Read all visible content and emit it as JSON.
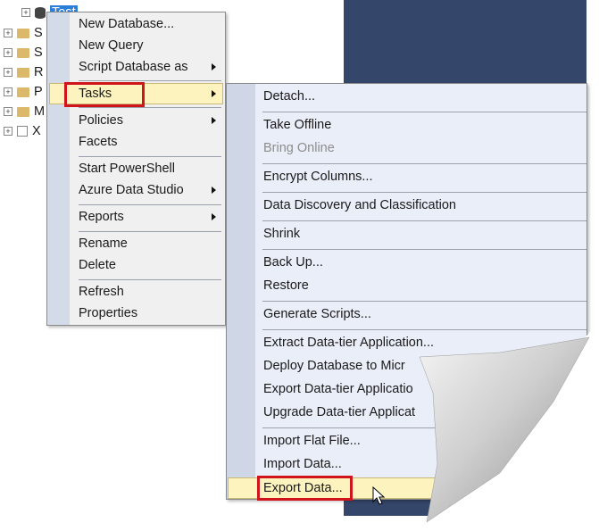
{
  "tree": {
    "selected": "Test",
    "items": [
      "S",
      "S",
      "R",
      "P",
      "M",
      "X"
    ]
  },
  "context_menu": [
    {
      "label": "New Database...",
      "sub": false
    },
    {
      "label": "New Query",
      "sub": false
    },
    {
      "label": "Script Database as",
      "sub": true
    },
    {
      "label": "Tasks",
      "sub": true,
      "highlighted": true
    },
    {
      "label": "Policies",
      "sub": true
    },
    {
      "label": "Facets",
      "sub": false
    },
    {
      "label": "Start PowerShell",
      "sub": false
    },
    {
      "label": "Azure Data Studio",
      "sub": true
    },
    {
      "label": "Reports",
      "sub": true
    },
    {
      "label": "Rename",
      "sub": false
    },
    {
      "label": "Delete",
      "sub": false
    },
    {
      "label": "Refresh",
      "sub": false
    },
    {
      "label": "Properties",
      "sub": false
    }
  ],
  "tasks_menu": [
    {
      "label": "Detach..."
    },
    {
      "label": "Take Offline"
    },
    {
      "label": "Bring Online",
      "disabled": true
    },
    {
      "label": "Encrypt Columns..."
    },
    {
      "label": "Data Discovery and Classification"
    },
    {
      "label": "Shrink"
    },
    {
      "label": "Back Up..."
    },
    {
      "label": "Restore"
    },
    {
      "label": "Generate Scripts..."
    },
    {
      "label": "Extract Data-tier Application..."
    },
    {
      "label": "Deploy Database to Micr"
    },
    {
      "label": "Export Data-tier Applicatio"
    },
    {
      "label": "Upgrade Data-tier Applicat"
    },
    {
      "label": "Import Flat File..."
    },
    {
      "label": "Import Data..."
    },
    {
      "label": "Export Data...",
      "highlighted": true
    }
  ],
  "colors": {
    "highlight_box": "#d0141c",
    "navy": "#34466a",
    "hover": "#fdf3bf"
  }
}
